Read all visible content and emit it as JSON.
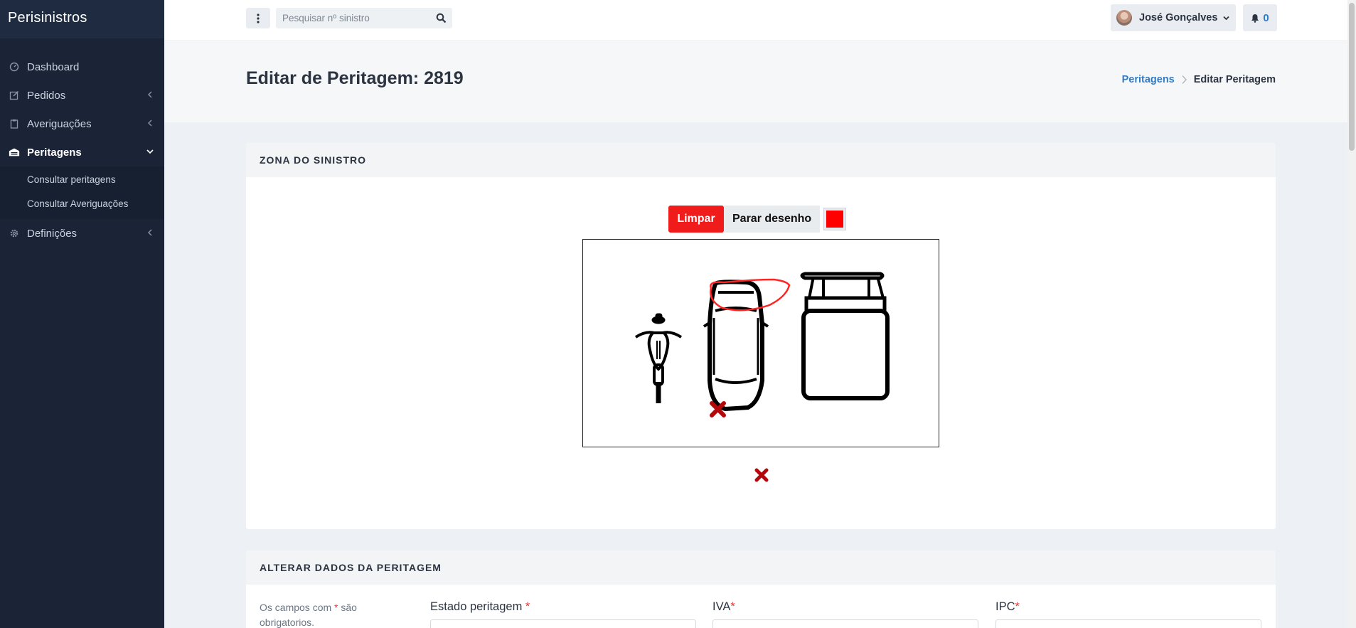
{
  "app": {
    "brand": "Perisinistros"
  },
  "sidebar": {
    "items": [
      {
        "label": "Dashboard",
        "icon": "dashboard-icon"
      },
      {
        "label": "Pedidos",
        "icon": "edit-icon"
      },
      {
        "label": "Averiguações",
        "icon": "clipboard-icon"
      },
      {
        "label": "Peritagens",
        "icon": "garage-icon",
        "active": true,
        "children": [
          {
            "label": "Consultar peritagens"
          },
          {
            "label": "Consultar Averiguações"
          }
        ]
      },
      {
        "label": "Definições",
        "icon": "gear-icon"
      }
    ]
  },
  "topbar": {
    "search_placeholder": "Pesquisar nº sinistro",
    "user_name": "José Gonçalves",
    "notifications_count": "0"
  },
  "page": {
    "title": "Editar de Peritagem: 2819",
    "breadcrumb": {
      "link": "Peritagens",
      "current": "Editar Peritagem"
    }
  },
  "zona": {
    "heading": "ZONA DO SINISTRO",
    "clear_label": "Limpar",
    "stop_label": "Parar desenho",
    "draw_color": "#ff0000",
    "mark_color": "#b3080c"
  },
  "form": {
    "heading": "ALTERAR DADOS DA PERITAGEM",
    "note_before": "Os campos com ",
    "note_star": "*",
    "note_after": " são obrigatorios.",
    "fields": [
      {
        "label": "Estado peritagem ",
        "required": "*"
      },
      {
        "label": "IVA",
        "required": "*"
      },
      {
        "label": "IPC",
        "required": "*"
      }
    ]
  }
}
